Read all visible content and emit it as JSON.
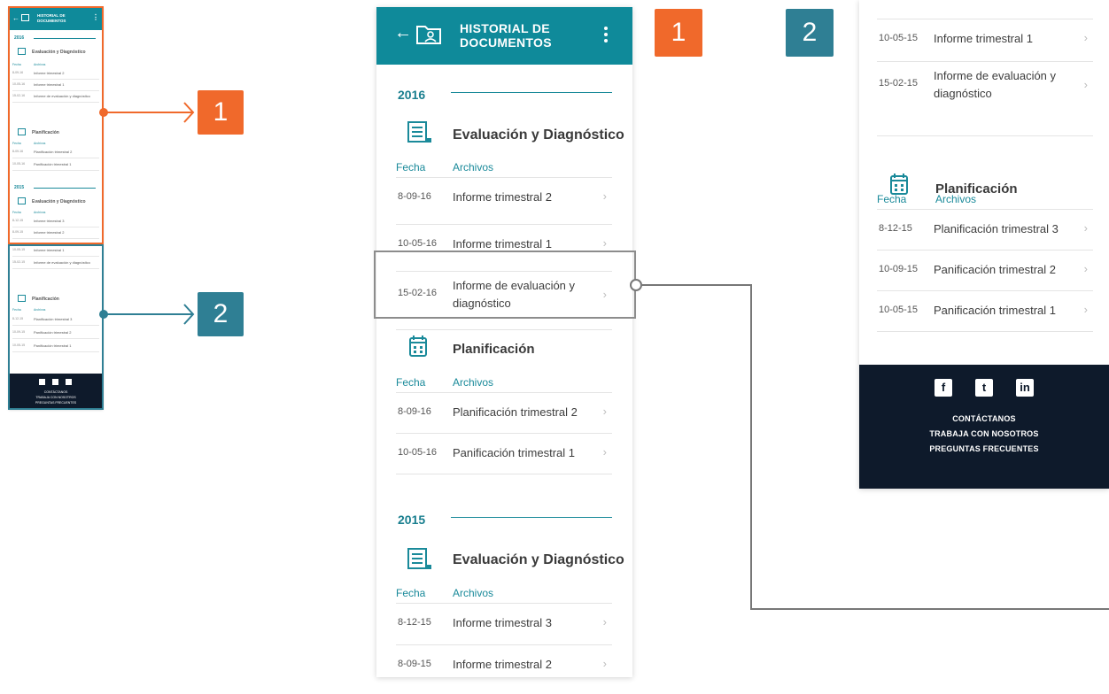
{
  "colors": {
    "teal": "#0f8a9a",
    "accent_text": "#1a8a9a",
    "orange_badge": "#f0692b",
    "blue_badge": "#2f7f94",
    "footer_bg": "#0e1a2b",
    "highlight_box": "#8c8c8c"
  },
  "badges": {
    "one": "1",
    "two": "2"
  },
  "app": {
    "title_line1": "HISTORIAL DE",
    "title_line2": "DOCUMENTOS",
    "back_icon": "arrow-left-icon",
    "folder_icon": "folder-user-icon",
    "menu_icon": "kebab-menu-icon"
  },
  "column_headers": {
    "date": "Fecha",
    "files": "Archivos"
  },
  "screen1": {
    "year_2016": "2016",
    "year_2015": "2015",
    "eval_title": "Evaluación y Diagnóstico",
    "plan_title": "Planificación",
    "eval_2016": [
      {
        "date": "8-09-16",
        "name": "Informe trimestral 2"
      },
      {
        "date": "10-05-16",
        "name": "Informe trimestral 1"
      },
      {
        "date": "15-02-16",
        "name": "Informe de evaluación y diagnóstico"
      }
    ],
    "plan_2016": [
      {
        "date": "8-09-16",
        "name": "Planificación trimestral 2"
      },
      {
        "date": "10-05-16",
        "name": "Panificación trimestral 1"
      }
    ],
    "eval_2015": [
      {
        "date": "8-12-15",
        "name": "Informe trimestral 3"
      },
      {
        "date": "8-09-15",
        "name": "Informe trimestral 2"
      }
    ]
  },
  "screen2": {
    "eval_rows": [
      {
        "date": "10-05-15",
        "name": "Informe trimestral 1"
      },
      {
        "date": "15-02-15",
        "name": "Informe de evaluación y diagnóstico"
      }
    ],
    "plan_title": "Planificación",
    "plan_rows": [
      {
        "date": "8-12-15",
        "name": "Planificación trimestral 3"
      },
      {
        "date": "10-09-15",
        "name": "Panificación trimestral 2"
      },
      {
        "date": "10-05-15",
        "name": "Panificación trimestral 1"
      }
    ],
    "footer": {
      "social": [
        "f",
        "t",
        "in"
      ],
      "contact": "CONTÁCTANOS",
      "work": "TRABAJA CON NOSOTROS",
      "faq": "PREGUNTAS FRECUENTES"
    }
  },
  "thumbnail": {
    "title_line1": "HISTORIAL DE",
    "title_line2": "DOCUMENTOS",
    "year_2016": "2016",
    "year_2015": "2015",
    "eval_title": "Evaluación y Diagnóstico",
    "plan_title": "Planificación",
    "col_date": "Fecha",
    "col_files": "Archivos",
    "rows_a": [
      {
        "date": "8-09-16",
        "name": "Informe trimestral 2"
      },
      {
        "date": "10-05-16",
        "name": "Informe trimestral 1"
      },
      {
        "date": "15-02-16",
        "name": "Informe de evaluación y diagnóstico"
      }
    ],
    "rows_b": [
      {
        "date": "8-09-16",
        "name": "Planificación trimestral 2"
      },
      {
        "date": "10-05-16",
        "name": "Panificación trimestral 1"
      }
    ],
    "rows_c": [
      {
        "date": "8-12-15",
        "name": "Informe trimestral 3"
      },
      {
        "date": "8-09-15",
        "name": "Informe trimestral 2"
      }
    ],
    "rows_d": [
      {
        "date": "10-05-15",
        "name": "Informe trimestral 1"
      },
      {
        "date": "15-02-15",
        "name": "Informe de evaluación y diagnóstico"
      }
    ],
    "rows_e": [
      {
        "date": "8-12-15",
        "name": "Planificación trimestral 3"
      },
      {
        "date": "10-09-15",
        "name": "Panificación trimestral 2"
      },
      {
        "date": "10-05-15",
        "name": "Panificación trimestral 1"
      }
    ],
    "footer_contact": "CONTÁCTANOS",
    "footer_work": "TRABAJA CON NOSOTROS",
    "footer_faq": "PREGUNTAS FRECUENTES"
  }
}
